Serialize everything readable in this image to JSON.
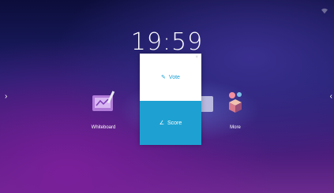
{
  "home": {
    "clock": "19:59"
  },
  "apps": [
    {
      "label": "Whiteboard",
      "icon": "whiteboard-icon"
    },
    {
      "label": "More",
      "icon": "more-apps-icon"
    }
  ],
  "popup": {
    "close": "×",
    "vote_label": "Vote",
    "vote_icon": "pencil-icon",
    "score_label": "Score",
    "score_icon": "ruler-angle-icon"
  },
  "nav": {
    "left_arrow": "›",
    "right_arrow": "‹"
  },
  "colors": {
    "accent": "#1ea1d2",
    "vote_text": "#1a9fd6"
  }
}
